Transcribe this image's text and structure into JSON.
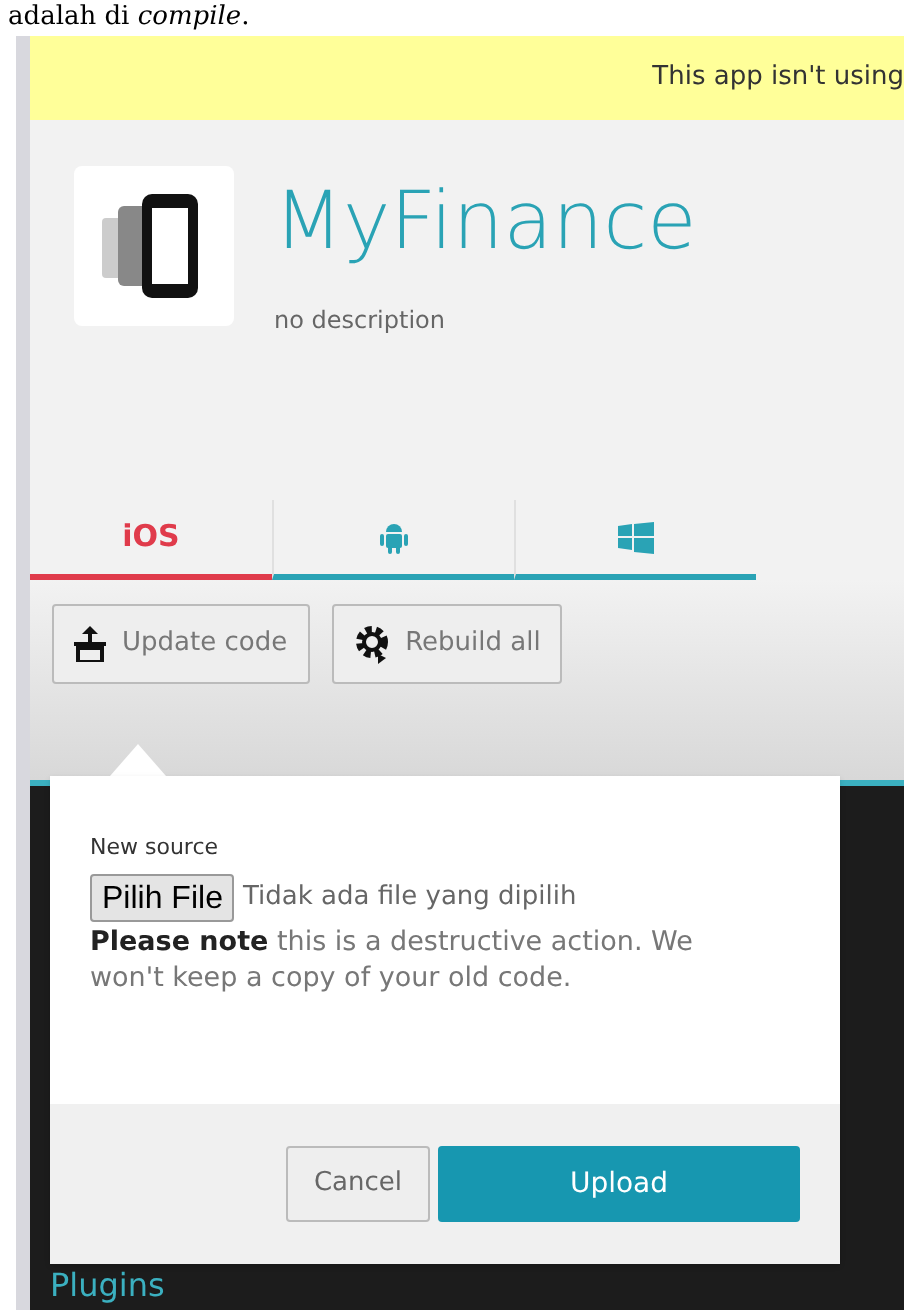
{
  "document_caption": "adalah di *compile*.",
  "banner": {
    "text": "This app isn't using"
  },
  "app": {
    "name": "MyFinance",
    "description": "no description"
  },
  "tabs": [
    {
      "kind": "text",
      "label": "iOS",
      "selected": true
    },
    {
      "kind": "android",
      "selected": false
    },
    {
      "kind": "windows",
      "selected": false
    }
  ],
  "actions": [
    {
      "kind": "upload",
      "label": "Update code"
    },
    {
      "kind": "rebuild",
      "label": "Rebuild all"
    }
  ],
  "popover": {
    "field_label": "New source",
    "file_button": "Pilih File",
    "file_status": "Tidak ada file yang dipilih",
    "note": "**Please note** this is a destructive action. We won't keep a copy of your old code.",
    "buttons": [
      {
        "kind": "secondary",
        "label": "Cancel"
      },
      {
        "kind": "primary",
        "label": "Upload"
      }
    ]
  },
  "sidebar": {
    "link": "Plugins"
  }
}
